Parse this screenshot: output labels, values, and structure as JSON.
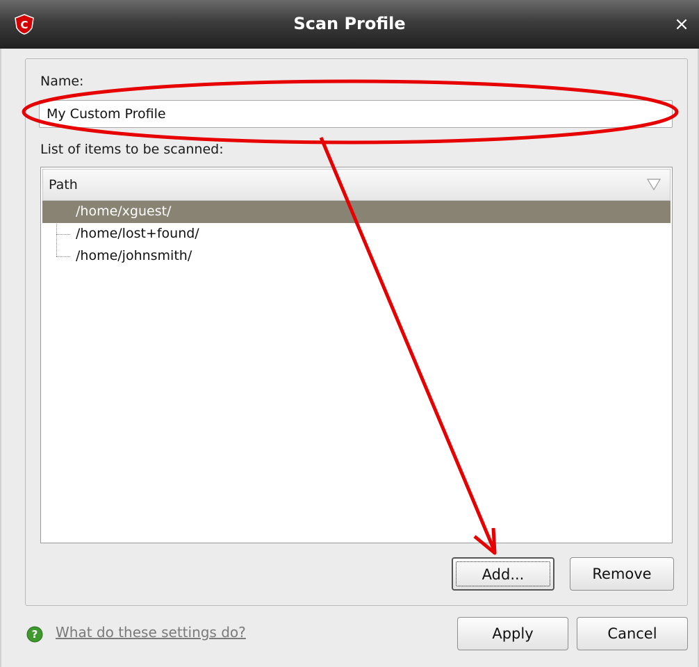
{
  "window": {
    "title": "Scan Profile",
    "close_glyph": "×",
    "app_icon": "comodo-shield-icon"
  },
  "form": {
    "name_label": "Name:",
    "name_value": "My Custom Profile",
    "items_label": "List of items to be scanned:"
  },
  "list": {
    "column_header": "Path",
    "rows": [
      {
        "path": "/home/xguest/",
        "selected": true
      },
      {
        "path": "/home/lost+found/",
        "selected": false
      },
      {
        "path": "/home/johnsmith/",
        "selected": false
      }
    ]
  },
  "buttons": {
    "add": "Add...",
    "remove": "Remove",
    "apply": "Apply",
    "cancel": "Cancel"
  },
  "help": {
    "link_text": "What do these settings do?",
    "icon": "help-question-icon"
  },
  "colors": {
    "selection": "#898374",
    "annotation": "#e60000"
  }
}
